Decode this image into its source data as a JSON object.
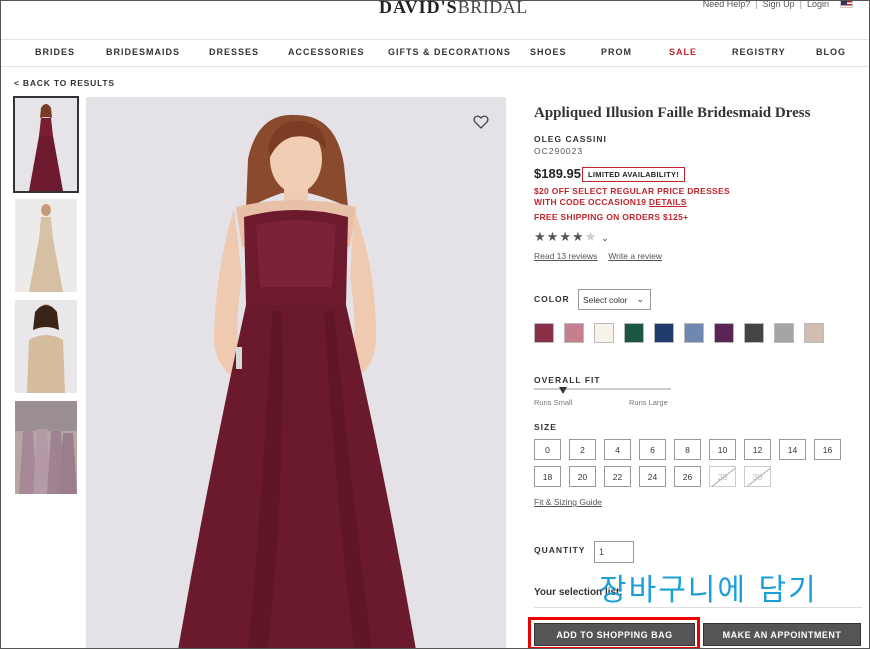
{
  "header": {
    "logo_bold": "DAVID'S",
    "logo_light": "BRIDAL",
    "utility_links": [
      "Need Help?",
      "Sign Up",
      "Login"
    ],
    "flag_icon": "us-flag-icon"
  },
  "nav": {
    "items": [
      "BRIDES",
      "BRIDESMAIDS",
      "DRESSES",
      "ACCESSORIES",
      "GIFTS & DECORATIONS",
      "SHOES",
      "PROM",
      "SALE",
      "REGISTRY",
      "BLOG"
    ],
    "sale_color": "#c0252b"
  },
  "back_link": "< BACK TO RESULTS",
  "product": {
    "title": "Appliqued Illusion Faille Bridesmaid Dress",
    "brand": "OLEG CASSINI",
    "sku": "OC290023",
    "price": "$189.95",
    "availability_badge": "LIMITED AVAILABILITY!",
    "promo_line1": "$20 OFF SELECT REGULAR PRICE DRESSES",
    "promo_line2_prefix": "WITH CODE OCCASION19 ",
    "promo_line2_link": "DETAILS",
    "shipping": "FREE SHIPPING ON ORDERS $125+",
    "rating": 4,
    "rating_max": 5,
    "reviews_link": "Read 13 reviews",
    "write_review_link": "Write a review"
  },
  "color": {
    "label": "COLOR",
    "select_placeholder": "Select color",
    "swatches": [
      "#8a2f47",
      "#c57f8e",
      "#f7f3ea",
      "#1d5640",
      "#1f3a6b",
      "#7088b0",
      "#5a2454",
      "#444444",
      "#a5a5a5",
      "#d1bdb1"
    ]
  },
  "fit": {
    "label": "OVERALL FIT",
    "left": "Runs Small",
    "right": "Runs Large"
  },
  "size": {
    "label": "SIZE",
    "row1": [
      "0",
      "2",
      "4",
      "6",
      "8",
      "10",
      "12",
      "14",
      "16"
    ],
    "row2": [
      "18",
      "20",
      "22",
      "24",
      "26",
      "28",
      "30"
    ],
    "unavailable": [
      "28",
      "30"
    ],
    "guide_link": "Fit & Sizing Guide"
  },
  "quantity": {
    "label": "QUANTITY",
    "value": "1"
  },
  "selection_label": "Your selection list:",
  "overlay_text": "장바구니에 담기",
  "buttons": {
    "add_to_bag": "ADD TO SHOPPING BAG",
    "appointment": "MAKE AN APPOINTMENT"
  },
  "colors": {
    "accent_red": "#c0252b",
    "button_gray": "#555555",
    "highlight": "#ee0000",
    "overlay": "#1a9fd9"
  }
}
